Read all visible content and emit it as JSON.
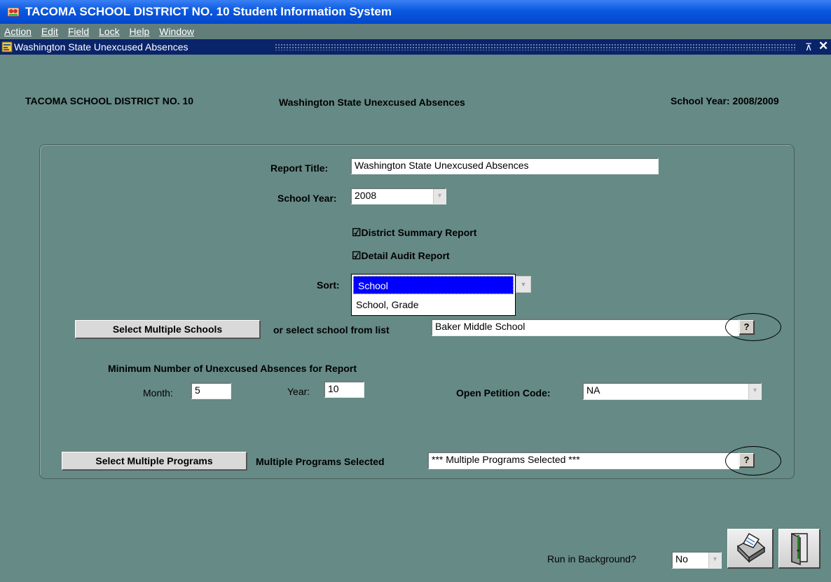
{
  "window": {
    "title": "TACOMA SCHOOL DISTRICT NO. 10 Student Information System",
    "menu": [
      "Action",
      "Edit",
      "Field",
      "Lock",
      "Help",
      "Window"
    ],
    "subwindow_title": "Washington State  Unexcused Absences"
  },
  "header": {
    "district": "TACOMA SCHOOL DISTRICT NO. 10",
    "report": "Washington State  Unexcused Absences",
    "school_year": "School Year: 2008/2009"
  },
  "form": {
    "report_title_label": "Report Title:",
    "report_title_value": "Washington State  Unexcused Absences",
    "school_year_label": "School Year:",
    "school_year_value": "2008",
    "district_summary_label": "District Summary Report",
    "detail_audit_label": "Detail Audit Report",
    "sort_label": "Sort:",
    "sort_options": [
      "School",
      "School, Grade"
    ],
    "select_schools_button": "Select Multiple Schools",
    "select_school_list_label": "or select school from list",
    "school_value": "Baker Middle School",
    "lov_button": "?",
    "min_absences_label": "Minimum Number of Unexcused Absences for Report",
    "month_label": "Month:",
    "month_value": "5",
    "year_label": "Year:",
    "year_value": "10",
    "petition_label": "Open Petition Code:",
    "petition_value": "NA",
    "select_programs_button": "Select Multiple Programs",
    "programs_label": "Multiple Programs Selected",
    "programs_value": "*** Multiple Programs Selected ***"
  },
  "footer": {
    "run_background_label": "Run in Background?",
    "run_background_value": "No"
  },
  "icons": [
    "app-icon",
    "form-icon",
    "maximize-icon",
    "close-icon",
    "checkbox-icon",
    "printer-icon",
    "exit-door-icon"
  ]
}
